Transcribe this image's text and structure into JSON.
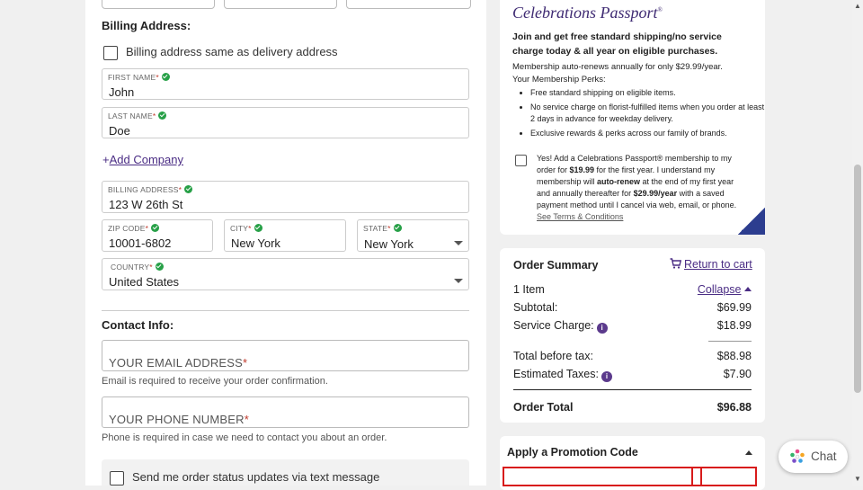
{
  "billing": {
    "heading": "Billing Address:",
    "same_as_delivery_label": "Billing address same as delivery address",
    "first_name": {
      "label": "FIRST NAME",
      "required_mark": "*",
      "value": "John"
    },
    "last_name": {
      "label": "LAST NAME",
      "required_mark": "*",
      "value": "Doe"
    },
    "add_company_plus": "+",
    "add_company_label": "Add Company",
    "address": {
      "label": "BILLING ADDRESS",
      "required_mark": "*",
      "value": "123 W 26th St"
    },
    "zip": {
      "label": "ZIP CODE",
      "required_mark": "*",
      "value": "10001-6802"
    },
    "city": {
      "label": "CITY",
      "required_mark": "*",
      "value": "New York"
    },
    "state": {
      "label": "STATE",
      "required_mark": "*",
      "value": "New York"
    },
    "country": {
      "label": "COUNTRY",
      "required_mark": "*",
      "value": "United States"
    }
  },
  "contact": {
    "heading": "Contact Info:",
    "email_placeholder": "YOUR EMAIL ADDRESS",
    "email_required_mark": "*",
    "email_help": "Email is required to receive your order confirmation.",
    "phone_placeholder": "YOUR PHONE NUMBER",
    "phone_required_mark": "*",
    "phone_help": "Phone is required in case we need to contact you about an order.",
    "sms_label": "Send me order status updates via text message"
  },
  "passport": {
    "brand": "Celebrations Passport",
    "brand_mark": "®",
    "headline_bold": "Join and get free standard shipping/no service charge today & all year on eligible purchases.",
    "headline_rest": " Membership auto-renews annually for only $29.99/year.",
    "perks_title": "Your Membership Perks:",
    "perks": [
      "Free standard shipping on eligible items.",
      "No service charge on florist-fulfilled items when you order at least 2 days in advance for weekday delivery.",
      "Exclusive rewards & perks across our family of brands."
    ],
    "optin_1": "Yes! Add a Celebrations Passport® membership to my order for ",
    "optin_price1": "$19.99",
    "optin_2": " for the first year. I understand my membership will ",
    "optin_autorenew": "auto-renew",
    "optin_3": " at the end of my first year and annually thereafter for ",
    "optin_price2": "$29.99/year",
    "optin_4": " with a saved payment method until I cancel via web, email, or phone.",
    "terms_link": "See Terms & Conditions"
  },
  "order_summary": {
    "title": "Order Summary",
    "return_to_cart": "Return to cart",
    "item_count": "1 Item",
    "collapse_label": "Collapse",
    "subtotal_label": "Subtotal:",
    "subtotal": "$69.99",
    "service_label": "Service Charge:",
    "service": "$18.99",
    "before_tax_label": "Total before tax:",
    "before_tax": "$88.98",
    "taxes_label": "Estimated Taxes:",
    "taxes": "$7.90",
    "total_label": "Order Total",
    "total": "$96.88",
    "info_glyph": "i"
  },
  "promo": {
    "title": "Apply a Promotion Code"
  },
  "chat": {
    "label": "Chat"
  },
  "colors": {
    "accent_purple": "#4a2c84",
    "valid_green": "#27a047",
    "required_red": "#c0392b",
    "promo_highlight": "#d81b1b"
  }
}
